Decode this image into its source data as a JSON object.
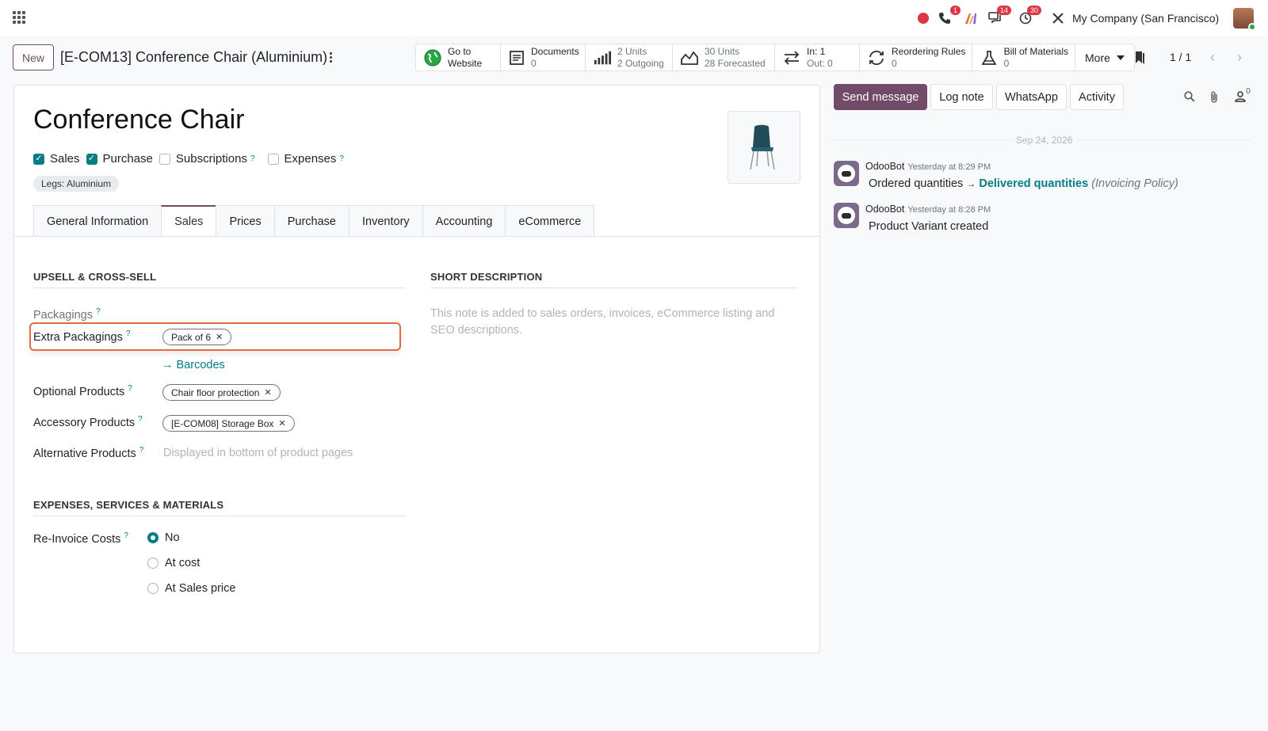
{
  "navbar": {
    "company": "My Company (San Francisco)",
    "badges": {
      "calls": "1",
      "messages": "14",
      "activities": "30"
    }
  },
  "control": {
    "new_label": "New",
    "record_title": "[E-COM13] Conference Chair (Aluminium)",
    "pager": "1 / 1",
    "more_label": "More"
  },
  "stats": [
    {
      "icon": "globe-icon",
      "line1": "Go to",
      "line2": "Website"
    },
    {
      "icon": "document-icon",
      "line1": "Documents",
      "line2": "0"
    },
    {
      "icon": "bar-chart-icon",
      "line1": "2 Units",
      "line2": "2 Outgoing"
    },
    {
      "icon": "area-chart-icon",
      "line1": "30 Units",
      "line2": "28 Forecasted"
    },
    {
      "icon": "exchange-icon",
      "line1": "In: 1",
      "line2": "Out: 0"
    },
    {
      "icon": "refresh-icon",
      "line1": "Reordering Rules",
      "line2": "0"
    },
    {
      "icon": "flask-icon",
      "line1": "Bill of Materials",
      "line2": "0"
    }
  ],
  "product": {
    "name": "Conference Chair",
    "flags": [
      {
        "label": "Sales",
        "checked": true
      },
      {
        "label": "Purchase",
        "checked": true
      },
      {
        "label": "Subscriptions",
        "checked": false
      },
      {
        "label": "Expenses",
        "checked": false
      }
    ],
    "attribute_tag": "Legs: Aluminium"
  },
  "tabs": [
    "General Information",
    "Sales",
    "Prices",
    "Purchase",
    "Inventory",
    "Accounting",
    "eCommerce"
  ],
  "active_tab": "Sales",
  "upsell": {
    "title": "UPSELL & CROSS-SELL",
    "packagings_label": "Packagings",
    "extra_packagings_label": "Extra Packagings",
    "extra_packagings_tag": "Pack of 6",
    "barcodes_link": "Barcodes",
    "optional_label": "Optional Products",
    "optional_tag": "Chair floor protection",
    "accessory_label": "Accessory Products",
    "accessory_tag": "[E-COM08] Storage Box",
    "alternative_label": "Alternative Products",
    "alternative_placeholder": "Displayed in bottom of product pages"
  },
  "short_description": {
    "title": "SHORT DESCRIPTION",
    "placeholder": "This note is added to sales orders, invoices, eCommerce listing and SEO descriptions."
  },
  "expenses": {
    "title": "EXPENSES, SERVICES & MATERIALS",
    "reinvoice_label": "Re-Invoice Costs",
    "options": [
      {
        "label": "No",
        "selected": true
      },
      {
        "label": "At cost",
        "selected": false
      },
      {
        "label": "At Sales price",
        "selected": false
      }
    ]
  },
  "chatter": {
    "send_message": "Send message",
    "log_note": "Log note",
    "whatsapp": "WhatsApp",
    "activity": "Activity",
    "followers_count": "0",
    "date_separator": "Sep 24, 2026",
    "messages": [
      {
        "author": "OdooBot",
        "time": "Yesterday at 8:29 PM",
        "from": "Ordered quantities",
        "arrow": "→",
        "to": "Delivered quantities",
        "field": "(Invoicing Policy)"
      },
      {
        "author": "OdooBot",
        "time": "Yesterday at 8:28 PM",
        "text": "Product Variant created"
      }
    ]
  },
  "colors": {
    "brand": "#714b67",
    "accent": "#017e84",
    "highlight": "#e26b3f"
  }
}
